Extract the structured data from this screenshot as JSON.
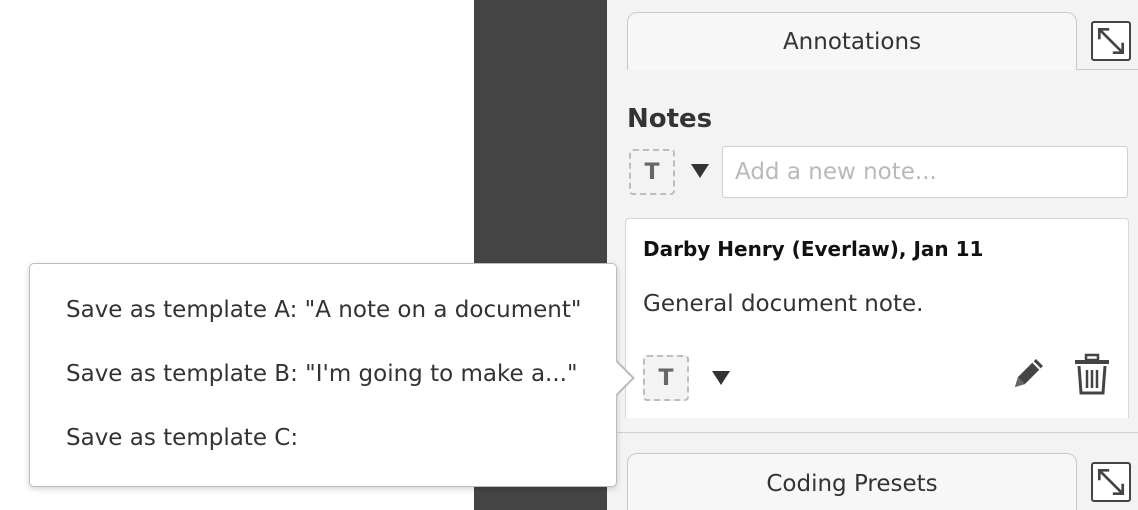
{
  "annotations_panel": {
    "tab_label": "Annotations",
    "notes_title": "Notes",
    "template_glyph": "T",
    "new_note_placeholder": "Add a new note...",
    "note": {
      "author_line": "Darby Henry (Everlaw), Jan 11",
      "body": "General document note."
    }
  },
  "coding_presets_panel": {
    "tab_label": "Coding Presets"
  },
  "template_menu": {
    "items": [
      "Save as template A: \"A note on a document\"",
      "Save as template B: \"I'm going to make a...\"",
      "Save as template C:"
    ]
  },
  "icons": {
    "expand": "expand-icon",
    "edit": "pencil-icon",
    "delete": "trash-icon",
    "dropdown": "caret-down-icon"
  },
  "colors": {
    "dark_strip": "#444444",
    "panel_bg": "#f3f3f3",
    "placeholder": "#b9b9b9",
    "text": "#333333"
  }
}
